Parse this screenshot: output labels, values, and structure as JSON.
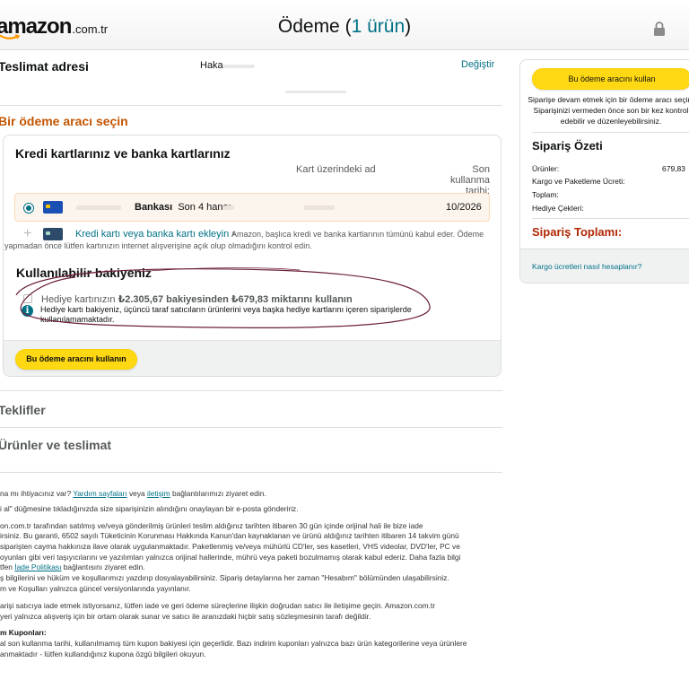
{
  "header": {
    "logo_text": "amazon",
    "logo_domain": ".com.tr",
    "title": "Ödeme",
    "item_count": "1 ürün"
  },
  "shipping": {
    "heading": "Teslimat adresi",
    "name": "Haka",
    "change_link": "Değiştir"
  },
  "payment": {
    "heading": "Bir ödeme aracı seçin",
    "cards_title": "Kredi kartlarınız ve banka kartlarınız",
    "col_name": "Kart üzerindeki ad",
    "col_expiry_1": "Son kullanma",
    "col_expiry_2": "tarihi:",
    "card": {
      "bank_label": "Bankası",
      "last_digits_label": "Son 4 hane:",
      "expiry": "10/2026"
    },
    "add_card_link": "Kredi kartı veya banka kartı ekleyin",
    "add_card_info": "Amazon, başlıca kredi ve banka kartlarının tümünü kabul eder. Ödeme yapmadan önce lütfen kartınızın internet alışverişine açık olup olmadığını kontrol edin.",
    "balance_title": "Kullanılabilir bakiyeniz",
    "gift_prefix": "Hediye kartınızın ",
    "gift_balance": "₺2.305,67 bakiyesinden ₺679,83 miktarını kullanın",
    "gift_note": "Hediye kartı bakiyeniz, üçüncü taraf satıcıların ürünlerini veya başka hediye kartlarını içeren siparişlerde kullanılamamaktadır.",
    "use_button": "Bu ödeme aracını kullanın"
  },
  "sections": {
    "offers": "Teklifler",
    "items": "Ürünler ve teslimat"
  },
  "footer": {
    "line1_a": "na mı ihtiyacınız var? ",
    "line1_link1": "Yardım sayfaları",
    "line1_b": " veya ",
    "line1_link2": "iletişim",
    "line1_c": " bağlantılarımızı ziyaret edin.",
    "line2": "i al\" düğmesine tıkladığınızda size siparişinizin alındığını onaylayan bir e-posta göndeririz.",
    "p3_1": "on.com.tr tarafından satılmış ve/veya gönderilmiş ürünleri teslim aldığınız tarihten itibaren 30 gün içinde orijinal hali ile bize iade",
    "p3_2": "irsiniz. Bu garanti, 6502 sayılı Tüketicinin Korunması Hakkında Kanun'dan kaynaklanan ve ürünü aldığınız tarihten itibaren 14 takvim günü",
    "p3_3": " siparişten cayma hakkınıza ilave olarak uygulanmaktadır. Paketlenmiş ve/veya mühürlü CD'ler, ses kasetleri, VHS videolar, DVD'ler, PC ve",
    "p3_4": "oyunları gibi veri taşıyıcılarını ve yazılımları yalnızca orijinal hallerinde, mührü veya paketi bozulmamış olarak kabul ederiz. Daha fazla bilgi",
    "p3_5a": "tfen ",
    "p3_5_link": "İade Politikası",
    "p3_5b": " bağlantısını ziyaret edin.",
    "p3_6": "ş bilgilerini ve hüküm ve koşullarımızı yazdırıp dosyalayabilirsiniz. Sipariş detaylarına her zaman \"Hesabım\" bölümünden ulaşabilirsiniz.",
    "p3_7": "m ve Koşulları yalnızca güncel versiyonlarında yayınlanır.",
    "p4_1": "arişi satıcıya iade etmek istiyorsanız, lütfen iade ve geri ödeme süreçlerine ilişkin doğrudan satıcı ile iletişime geçin. Amazon.com.tr",
    "p4_2": "yeri yalnızca alışveriş için bir ortam olarak sunar ve satıcı ile aranızdaki hiçbir satış sözleşmesinin tarafı değildir.",
    "p5_title": "m Kuponları:",
    "p5_1": "al son kullanma tarihi, kullanılmamış tüm kupon bakiyesi için geçerlidir. Bazı indirim kuponları yalnızca bazı ürün kategorilerine veya ürünlere",
    "p5_2": "anmaktadır - lütfen kullandığınız kupona özgü bilgileri okuyun."
  },
  "summary": {
    "use_button": "Bu ödeme aracını kullan",
    "note": "Siparişe devam etmek için bir ödeme aracı seçin. Siparişinizi vermeden önce son bir kez kontrol edebilir ve düzenleyebilirsiniz.",
    "title": "Sipariş Özeti",
    "rows": [
      {
        "label": "Ürünler:",
        "value": "679,83"
      },
      {
        "label": "Kargo ve Paketleme Ücreti:",
        "value": ""
      },
      {
        "label": "Toplam:",
        "value": ""
      },
      {
        "label": "Hediye Çekleri:",
        "value": ""
      }
    ],
    "order_total": "Sipariş Toplamı:",
    "shipping_link": "Kargo ücretleri nasıl hesaplanır?"
  },
  "colors": {
    "accent_teal": "#007185",
    "heading_orange": "#C45500",
    "price_red": "#B12704",
    "button_yellow": "#FFD814",
    "annotation_ink": "#6b1f3a"
  },
  "icons": [
    "lock-icon",
    "radio-selected-icon",
    "card-icon",
    "plus-icon",
    "info-icon"
  ]
}
